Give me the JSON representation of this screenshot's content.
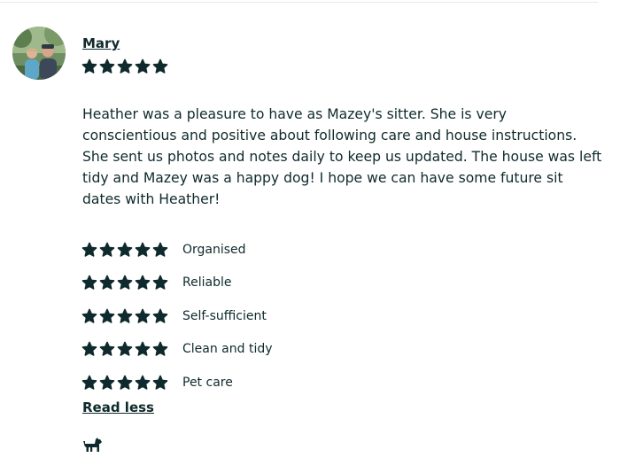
{
  "review": {
    "reviewer_name": "Mary",
    "overall_rating": 5,
    "text": "Heather was a pleasure to have as Mazey's sitter. She is very conscientious and positive about following care and house instructions. She sent us photos and notes daily to keep us updated. The house was left tidy and Mazey was a happy dog! I hope we can have some future sit dates with Heather!",
    "categories": [
      {
        "label": "Organised",
        "rating": 5
      },
      {
        "label": "Reliable",
        "rating": 5
      },
      {
        "label": "Self-sufficient",
        "rating": 5
      },
      {
        "label": "Clean and tidy",
        "rating": 5
      },
      {
        "label": "Pet care",
        "rating": 5
      }
    ],
    "read_less_label": "Read less",
    "pet_icon": "dog-icon"
  },
  "colors": {
    "text": "#0f2a2c",
    "star": "#0f2a2c",
    "divider": "#e7ebeb"
  }
}
